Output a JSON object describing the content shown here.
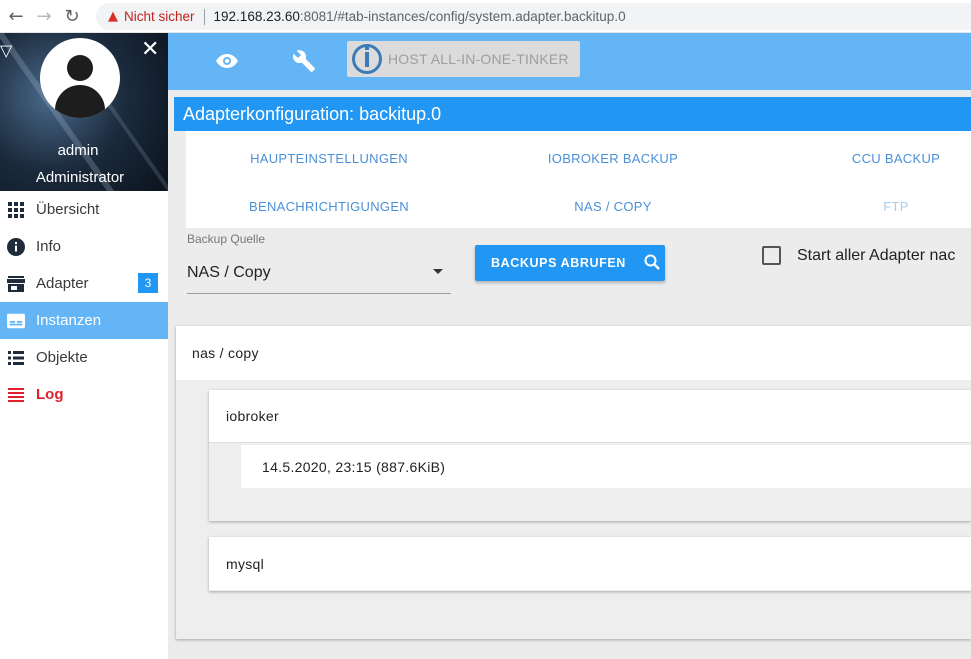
{
  "browser": {
    "security_label": "Nicht sicher",
    "url_host": "192.168.23.60",
    "url_rest": ":8081/#tab-instances/config/system.adapter.backitup.0"
  },
  "sidebar": {
    "user_name": "admin",
    "user_role": "Administrator",
    "items": [
      {
        "label": "Übersicht",
        "icon": "apps-grid-icon"
      },
      {
        "label": "Info",
        "icon": "info-icon"
      },
      {
        "label": "Adapter",
        "icon": "store-icon",
        "badge": "3"
      },
      {
        "label": "Instanzen",
        "icon": "instances-icon",
        "active": true
      },
      {
        "label": "Objekte",
        "icon": "list-icon"
      },
      {
        "label": "Log",
        "icon": "log-lines-icon"
      }
    ]
  },
  "toolbar": {
    "host_label": "HOST ALL-IN-ONE-TINKER"
  },
  "config": {
    "title": "Adapterkonfiguration: backitup.0",
    "tabs": [
      "HAUPTEINSTELLUNGEN",
      "IOBROKER BACKUP",
      "CCU BACKUP",
      "BENACHRICHTIGUNGEN",
      "NAS / COPY",
      "FTP"
    ],
    "source_label": "Backup Quelle",
    "source_value": "NAS / Copy",
    "fetch_button": "BACKUPS ABRUFEN",
    "checkbox_label": "Start aller Adapter nac"
  },
  "results": {
    "group_title": "nas / copy",
    "sections": [
      {
        "title": "iobroker",
        "entries": [
          "14.5.2020, 23:15 (887.6KiB)"
        ]
      },
      {
        "title": "mysql",
        "entries": []
      }
    ]
  },
  "colors": {
    "toolbar": "#64b5f6",
    "primary": "#2196f3",
    "log": "#e0212b"
  }
}
